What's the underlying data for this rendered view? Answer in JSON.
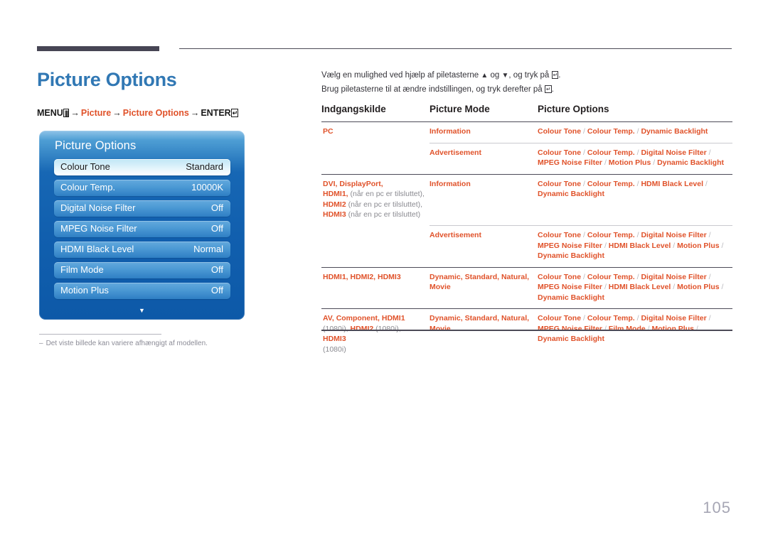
{
  "header": {
    "title": "Picture Options",
    "breadcrumb": {
      "menu_label": "MENU",
      "menu_icon": "menu-grid-icon",
      "arrow": "→",
      "item1": "Picture",
      "item2": "Picture Options",
      "enter_label": "ENTER",
      "enter_icon": "enter-key-icon"
    }
  },
  "osd": {
    "title": "Picture Options",
    "items": [
      {
        "label": "Colour Tone",
        "value": "Standard",
        "selected": true
      },
      {
        "label": "Colour Temp.",
        "value": "10000K",
        "selected": false
      },
      {
        "label": "Digital Noise Filter",
        "value": "Off",
        "selected": false
      },
      {
        "label": "MPEG Noise Filter",
        "value": "Off",
        "selected": false
      },
      {
        "label": "HDMI Black Level",
        "value": "Normal",
        "selected": false
      },
      {
        "label": "Film Mode",
        "value": "Off",
        "selected": false
      },
      {
        "label": "Motion Plus",
        "value": "Off",
        "selected": false
      }
    ],
    "more_arrow": "▼"
  },
  "footnote": {
    "dash": "–",
    "text": "Det viste billede kan variere afhængigt af modellen."
  },
  "intro": {
    "line1_a": "Vælg en mulighed ved hjælp af piletasterne",
    "line1_up": "▲",
    "line1_b": "og",
    "line1_down": "▼",
    "line1_c": ", og tryk på",
    "line1_d": ".",
    "line2_a": "Brug piletasterne til at ændre indstillingen, og tryk derefter på",
    "line2_b": "."
  },
  "table": {
    "headers": {
      "col1": "Indgangskilde",
      "col2": "Picture Mode",
      "col3": "Picture Options"
    },
    "rows": [
      {
        "group": true,
        "source": [
          {
            "t": "PC",
            "gray": false
          }
        ],
        "mode": [
          {
            "t": "Information",
            "gray": false
          }
        ],
        "options": [
          "Colour Tone",
          "Colour Temp.",
          "Dynamic Backlight"
        ]
      },
      {
        "group": false,
        "source": [],
        "mode": [
          {
            "t": "Advertisement",
            "gray": false
          }
        ],
        "options": [
          "Colour Tone",
          "Colour Temp.",
          "Digital Noise Filter",
          "MPEG Noise Filter",
          "Motion Plus",
          "Dynamic Backlight"
        ]
      },
      {
        "group": true,
        "source": [
          {
            "t": "DVI",
            "gray": false
          },
          {
            "t": ", ",
            "gray": false
          },
          {
            "t": "DisplayPort",
            "gray": false
          },
          {
            "t": ",",
            "gray": false
          },
          {
            "t": "\n",
            "gray": false
          },
          {
            "t": "HDMI1,",
            "gray": false
          },
          {
            "t": " (når en pc er tilsluttet),",
            "gray": true
          },
          {
            "t": "\n",
            "gray": false
          },
          {
            "t": "HDMI2",
            "gray": false
          },
          {
            "t": " (når en pc er tilsluttet),",
            "gray": true
          },
          {
            "t": "\n",
            "gray": false
          },
          {
            "t": "HDMI3",
            "gray": false
          },
          {
            "t": " (når en pc er tilsluttet)",
            "gray": true
          }
        ],
        "mode": [
          {
            "t": "Information",
            "gray": false
          }
        ],
        "options": [
          "Colour Tone",
          "Colour Temp.",
          "HDMI Black Level",
          "Dynamic Backlight"
        ]
      },
      {
        "group": false,
        "source": [],
        "mode": [
          {
            "t": "Advertisement",
            "gray": false
          }
        ],
        "options": [
          "Colour Tone",
          "Colour Temp.",
          "Digital Noise Filter",
          "MPEG Noise Filter",
          "HDMI Black Level",
          "Motion Plus",
          "Dynamic Backlight"
        ]
      },
      {
        "group": true,
        "source": [
          {
            "t": "HDMI1, HDMI2, HDMI3",
            "gray": false
          }
        ],
        "mode": [
          {
            "t": "Dynamic, Standard, Natural, Movie",
            "gray": false
          }
        ],
        "options": [
          "Colour Tone",
          "Colour Temp.",
          "Digital Noise Filter",
          "MPEG Noise Filter",
          "HDMI Black Level",
          "Motion Plus",
          "Dynamic Backlight"
        ]
      },
      {
        "group": true,
        "source": [
          {
            "t": "AV",
            "gray": false
          },
          {
            "t": ", ",
            "gray": false
          },
          {
            "t": "Component",
            "gray": false
          },
          {
            "t": ", ",
            "gray": false
          },
          {
            "t": "HDMI1",
            "gray": false
          },
          {
            "t": "\n",
            "gray": false
          },
          {
            "t": "(1080i), ",
            "gray": true
          },
          {
            "t": "HDMI2",
            "gray": false
          },
          {
            "t": " (1080i), ",
            "gray": true
          },
          {
            "t": "HDMI3",
            "gray": false
          },
          {
            "t": "\n",
            "gray": false
          },
          {
            "t": "(1080i)",
            "gray": true
          }
        ],
        "mode": [
          {
            "t": "Dynamic, Standard, Natural, Movie",
            "gray": false
          }
        ],
        "options": [
          "Colour Tone",
          "Colour Temp.",
          "Digital Noise Filter",
          "MPEG Noise Filter",
          "Film Mode",
          "Motion Plus",
          "Dynamic Backlight"
        ]
      }
    ]
  },
  "page_number": "105",
  "colors": {
    "accent_orange": "#e0522a",
    "title_blue": "#3178b4",
    "rule_dark": "#4c4a57",
    "gray_text": "#8a8a90"
  }
}
